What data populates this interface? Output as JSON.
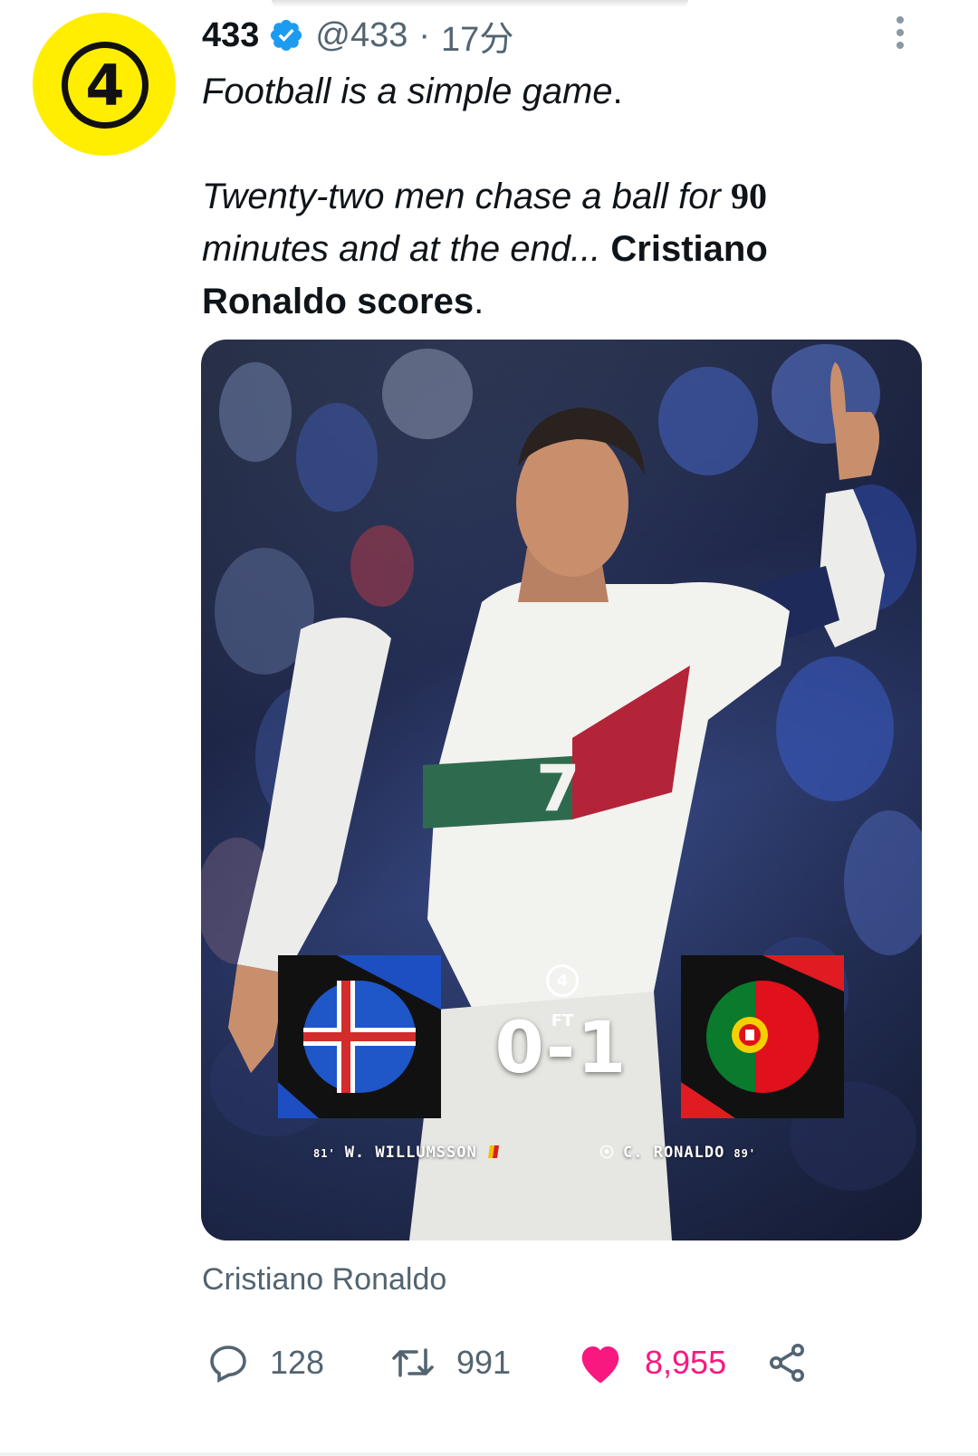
{
  "account": {
    "name": "433",
    "handle": "@433",
    "separator": "·",
    "time": "17分",
    "avatar_label": "4"
  },
  "tweet": {
    "line1": "Football is a simple game",
    "line1_end": ".",
    "line2_part1": "Twenty-two men chase a ball for ",
    "line2_num": "90",
    "line3_part1": "minutes and at the end... ",
    "line3_bold": "Cristiano",
    "line4_bold": "Ronaldo scores",
    "line4_end": "."
  },
  "media": {
    "logo": "4",
    "score": "0-1",
    "status": "FT",
    "home_scorer": {
      "minute": "81'",
      "name": "W. WILLUMSSON"
    },
    "away_scorer": {
      "name": "C. RONALDO",
      "minute": "89'"
    },
    "shirt_number": "7"
  },
  "caption": "Cristiano Ronaldo",
  "actions": {
    "replies": "128",
    "retweets": "991",
    "likes": "8,955"
  },
  "icons": {
    "verified": "verified-badge-icon",
    "more": "more-vertical-icon",
    "reply": "reply-icon",
    "retweet": "retweet-icon",
    "like": "heart-icon",
    "share": "share-icon"
  },
  "colors": {
    "like": "#f91880",
    "verified": "#1d9bf0",
    "secondary_text": "#536471",
    "avatar_bg": "#ffee00"
  }
}
